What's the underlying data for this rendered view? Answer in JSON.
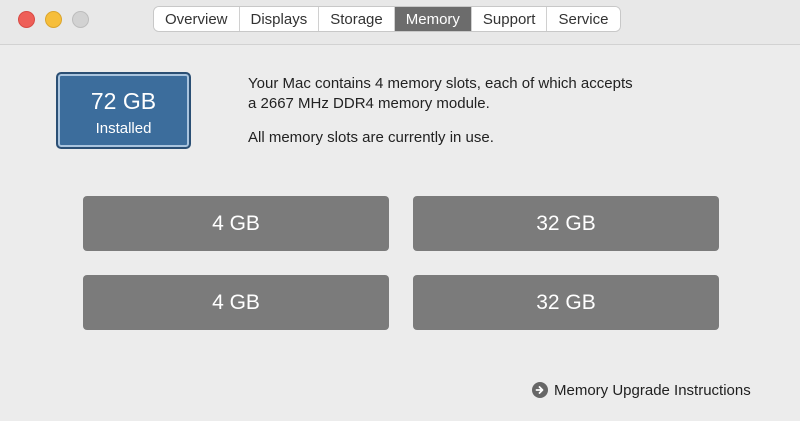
{
  "tabs": [
    "Overview",
    "Displays",
    "Storage",
    "Memory",
    "Support",
    "Service"
  ],
  "active_tab": "Memory",
  "summary": {
    "amount": "72 GB",
    "label": "Installed"
  },
  "info": {
    "line1": "Your Mac contains 4 memory slots, each of which accepts",
    "line2": "a 2667 MHz DDR4 memory module.",
    "status": "All memory slots are currently in use."
  },
  "slots": [
    "4 GB",
    "32 GB",
    "4 GB",
    "32 GB"
  ],
  "upgrade_link": "Memory Upgrade Instructions",
  "colors": {
    "active_tab": "#6c6c6c",
    "badge": "#3c6d9c",
    "slot": "#7b7b7b"
  },
  "icons": {
    "upgrade": "arrow-circle-right-icon"
  }
}
